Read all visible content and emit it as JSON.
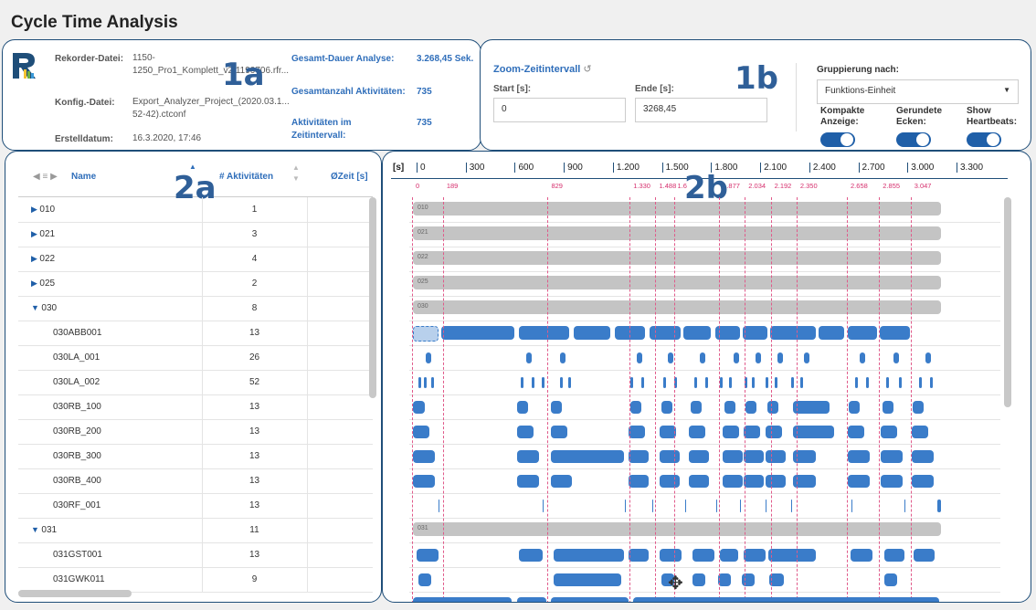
{
  "title": "Cycle Time Analysis",
  "panel_labels": {
    "info": "1a",
    "zoom": "1b",
    "tree": "2a",
    "timeline": "2b"
  },
  "info": {
    "rekorder_label": "Rekorder-Datei:",
    "rekorder_value": "1150-\n1250_Pro1_Komplett_v2.1190706.rfr...",
    "konfig_label": "Konfig.-Datei:",
    "konfig_value": "Export_Analyzer_Project_(2020.03.1...\n52-42).ctconf",
    "erstell_label": "Erstelldatum:",
    "erstell_value": "16.3.2020, 17:46",
    "dauer_label": "Gesamt-Dauer Analyse:",
    "dauer_value": "3.268,45 Sek.",
    "anzahl_label": "Gesamtanzahl Aktivitäten:",
    "anzahl_value": "735",
    "intervall_label": "Aktivitäten im\nZeitintervall:",
    "intervall_value": "735"
  },
  "zoom": {
    "title": "Zoom-Zeitintervall",
    "start_label": "Start [s]:",
    "start_value": "0",
    "end_label": "Ende [s]:",
    "end_value": "3268,45",
    "grouping_label": "Gruppierung nach:",
    "grouping_value": "Funktions-Einheit",
    "toggles": [
      {
        "label": "Kompakte\nAnzeige:",
        "on": true
      },
      {
        "label": "Gerundete\nEcken:",
        "on": true
      },
      {
        "label": "Show\nHeartbeats:",
        "on": true
      }
    ]
  },
  "tree": {
    "col_name": "Name",
    "col_count": "# Aktivitäten",
    "col_time": "ØZeit [s]",
    "rows": [
      {
        "name": "010",
        "count": "1",
        "level": 0,
        "expanded": false
      },
      {
        "name": "021",
        "count": "3",
        "level": 0,
        "expanded": false
      },
      {
        "name": "022",
        "count": "4",
        "level": 0,
        "expanded": false
      },
      {
        "name": "025",
        "count": "2",
        "level": 0,
        "expanded": false
      },
      {
        "name": "030",
        "count": "8",
        "level": 0,
        "expanded": true
      },
      {
        "name": "030ABB001",
        "count": "13",
        "level": 1
      },
      {
        "name": "030LA_001",
        "count": "26",
        "level": 1
      },
      {
        "name": "030LA_002",
        "count": "52",
        "level": 1
      },
      {
        "name": "030RB_100",
        "count": "13",
        "level": 1
      },
      {
        "name": "030RB_200",
        "count": "13",
        "level": 1
      },
      {
        "name": "030RB_300",
        "count": "13",
        "level": 1
      },
      {
        "name": "030RB_400",
        "count": "13",
        "level": 1
      },
      {
        "name": "030RF_001",
        "count": "13",
        "level": 1
      },
      {
        "name": "031",
        "count": "11",
        "level": 0,
        "expanded": true
      },
      {
        "name": "031GST001",
        "count": "13",
        "level": 1
      },
      {
        "name": "031GWK011",
        "count": "9",
        "level": 1
      }
    ]
  },
  "timeline": {
    "unit": "[s]",
    "ticks": [
      "0",
      "300",
      "600",
      "900",
      "1.200",
      "1.500",
      "1.800",
      "2.100",
      "2.400",
      "2.700",
      "3.000",
      "3.300"
    ],
    "markers": [
      "0",
      "189",
      "829",
      "1.330",
      "1.488",
      "1.6",
      "1.877",
      "2.034",
      "2.192",
      "2.350",
      "2.658",
      "2.855",
      "3.047"
    ],
    "group_rows": [
      "010",
      "021",
      "022",
      "025",
      "030",
      "031"
    ]
  },
  "colors": {
    "accent": "#1f5fa8",
    "bar": "#3a7cc9",
    "group_bar": "#c4c4c4",
    "marker": "#e05a8a"
  },
  "icons": [
    "logo-r-icon",
    "reset-icon",
    "dropdown-caret-icon",
    "sort-up-icon",
    "sort-down-icon",
    "column-menu-icon",
    "expand-triangle-icon",
    "cursor-icon"
  ]
}
